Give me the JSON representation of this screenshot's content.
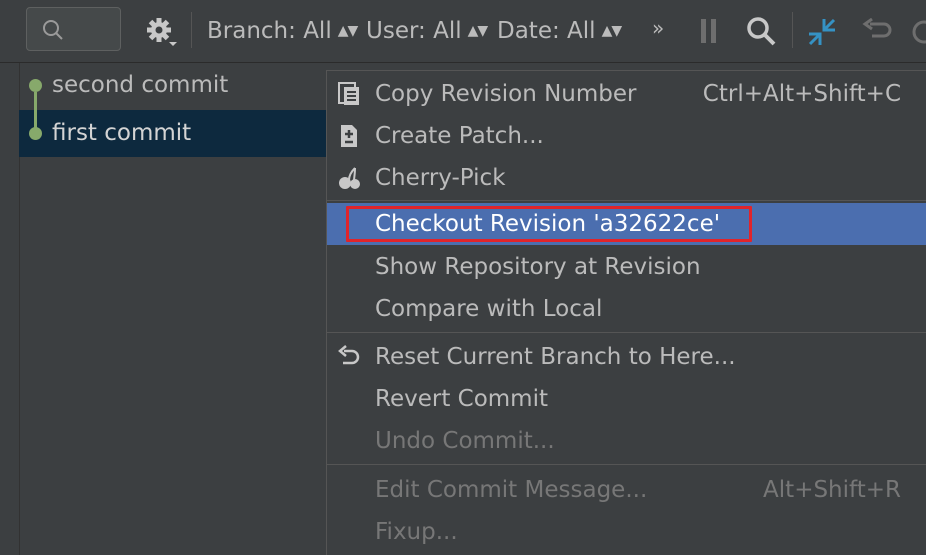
{
  "toolbar": {
    "search_placeholder": "",
    "filters": [
      {
        "label": "Branch: All",
        "arrows": "▲▼"
      },
      {
        "label": "User: All",
        "arrows": "▲▼"
      },
      {
        "label": "Date: All",
        "arrows": "▲▼"
      }
    ],
    "overflow": "»"
  },
  "commits": [
    {
      "label": "second commit",
      "selected": false
    },
    {
      "label": "first commit",
      "selected": true
    }
  ],
  "menu": {
    "items": [
      {
        "label": "Copy Revision Number",
        "shortcut": "Ctrl+Alt+Shift+C",
        "icon": "copy-icon"
      },
      {
        "label": "Create Patch...",
        "shortcut": "",
        "icon": "patch-icon"
      },
      {
        "label": "Cherry-Pick",
        "shortcut": "",
        "icon": "cherry-icon"
      },
      {
        "label": "Checkout Revision 'a32622ce'",
        "shortcut": "",
        "icon": ""
      },
      {
        "label": "Show Repository at Revision",
        "shortcut": "",
        "icon": ""
      },
      {
        "label": "Compare with Local",
        "shortcut": "",
        "icon": ""
      },
      {
        "label": "Reset Current Branch to Here...",
        "shortcut": "",
        "icon": "undo-icon"
      },
      {
        "label": "Revert Commit",
        "shortcut": "",
        "icon": ""
      },
      {
        "label": "Undo Commit...",
        "shortcut": "",
        "icon": ""
      },
      {
        "label": "Edit Commit Message...",
        "shortcut": "Alt+Shift+R",
        "icon": ""
      },
      {
        "label": "Fixup...",
        "shortcut": "",
        "icon": ""
      }
    ]
  },
  "colors": {
    "highlight": "#4b6eaf",
    "selection": "#0d293e",
    "graph": "#87a96b",
    "callout": "#e0242b",
    "accent_blue": "#3592c4"
  }
}
